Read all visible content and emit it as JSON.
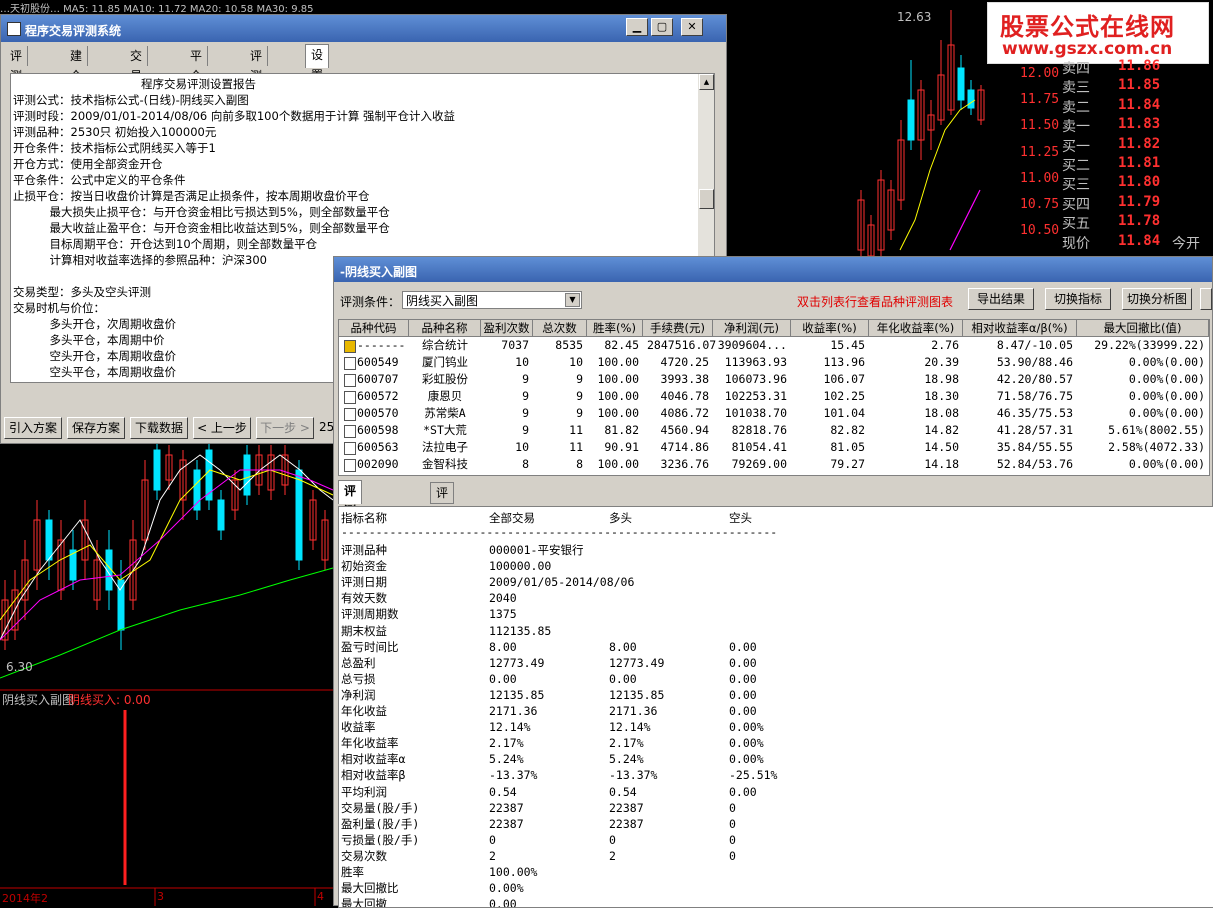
{
  "chart_bg": {
    "top_header": "…天初股份…  MA5: 11.85  MA10: 11.72  MA20: 10.58  MA30: 9.85",
    "high_label": "12.63",
    "price_axis": [
      "12.00",
      "11.75",
      "11.50",
      "11.25",
      "11.00",
      "10.75",
      "10.50"
    ],
    "low_label": "6.30",
    "sub_title": "阴线买入副图",
    "sub_value": "阴线买入: 0.00",
    "x_labels": [
      "2014年2",
      "3",
      "4"
    ],
    "colors": {
      "up": "#ff3030",
      "down": "#00e5ff",
      "ma1": "#ffffff",
      "ma2": "#ffff00",
      "ma3": "#ff00ff",
      "ma4": "#00ff00"
    }
  },
  "watermark": {
    "line1": "股票公式在线网",
    "line2": "www.gszx.com.cn"
  },
  "quotes": [
    {
      "label": "卖四",
      "value": "11.86"
    },
    {
      "label": "卖三",
      "value": "11.85"
    },
    {
      "label": "卖二",
      "value": "11.84"
    },
    {
      "label": "卖一",
      "value": "11.83"
    },
    {
      "label": "买一",
      "value": "11.82"
    },
    {
      "label": "买二",
      "value": "11.81"
    },
    {
      "label": "买三",
      "value": "11.80"
    },
    {
      "label": "买四",
      "value": "11.79"
    },
    {
      "label": "买五",
      "value": "11.78"
    },
    {
      "label": "现价",
      "value": "11.84",
      "extra": "今开"
    }
  ],
  "win1": {
    "title": "程序交易评测系统",
    "tabs": [
      "评测公式",
      "建仓规则",
      "交易方式",
      "平仓规则",
      "评测品种",
      "设置报告"
    ],
    "report_lines": [
      "                                   程序交易评测设置报告",
      "评测公式：技术指标公式-(日线)-阴线买入副图",
      "评测时段：2009/01/01-2014/08/06 向前多取100个数据用于计算 强制平仓计入收益",
      "评测品种：2530只 初始投入100000元",
      "开仓条件：技术指标公式阴线买入等于1",
      "开仓方式：使用全部资金开仓",
      "平仓条件：公式中定义的平仓条件",
      "止损平仓：按当日收盘价计算是否满足止损条件，按本周期收盘价平仓",
      "          最大损失止损平仓：与开仓资金相比亏损达到5%，则全部数量平仓",
      "          最大收益止盈平仓：与开仓资金相比收益达到5%，则全部数量平仓",
      "          目标周期平仓：开仓达到10个周期，则全部数量平仓",
      "          计算相对收益率选择的参照品种：沪深300",
      "",
      "交易类型：多头及空头评测",
      "交易时机与价位：",
      "          多头开仓，次周期收盘价",
      "          多头平仓，本周期中价",
      "          空头开仓，本周期收盘价",
      "          空头平仓，本周期收盘价"
    ],
    "buttons": [
      "引入方案",
      "保存方案",
      "下载数据",
      "< 上一步",
      "下一步 >"
    ],
    "trail": "25"
  },
  "win2": {
    "title": "-阴线买入副图",
    "cond_label": "评测条件：",
    "cond_value": "阴线买入副图",
    "hint": "双击列表行查看品种评测图表",
    "buttons": [
      "导出结果",
      "切换指标",
      "切换分析图"
    ],
    "columns": [
      "品种代码",
      "品种名称",
      "盈利次数",
      "总次数",
      "胜率(%)",
      "手续费(元)",
      "净利润(元)",
      "收益率(%)",
      "年化收益率(%)",
      "相对收益率α/β(%)",
      "最大回撤比(值)"
    ],
    "rows": [
      [
        "-------",
        "综合统计",
        "7037",
        "8535",
        "82.45",
        "2847516.07",
        "3909604...",
        "15.45",
        "2.76",
        "8.47/-10.05",
        "29.22%(33999.22)"
      ],
      [
        "600549",
        "厦门钨业",
        "10",
        "10",
        "100.00",
        "4720.25",
        "113963.93",
        "113.96",
        "20.39",
        "53.90/88.46",
        "0.00%(0.00)"
      ],
      [
        "600707",
        "彩虹股份",
        "9",
        "9",
        "100.00",
        "3993.38",
        "106073.96",
        "106.07",
        "18.98",
        "42.20/80.57",
        "0.00%(0.00)"
      ],
      [
        "600572",
        "康恩贝",
        "9",
        "9",
        "100.00",
        "4046.78",
        "102253.31",
        "102.25",
        "18.30",
        "71.58/76.75",
        "0.00%(0.00)"
      ],
      [
        "000570",
        "苏常柴A",
        "9",
        "9",
        "100.00",
        "4086.72",
        "101038.70",
        "101.04",
        "18.08",
        "46.35/75.53",
        "0.00%(0.00)"
      ],
      [
        "600598",
        "*ST大荒",
        "9",
        "11",
        "81.82",
        "4560.94",
        "82818.76",
        "82.82",
        "14.82",
        "41.28/57.31",
        "5.61%(8002.55)"
      ],
      [
        "600563",
        "法拉电子",
        "10",
        "11",
        "90.91",
        "4714.86",
        "81054.41",
        "81.05",
        "14.50",
        "35.84/55.55",
        "2.58%(4072.33)"
      ],
      [
        "002090",
        "金智科技",
        "8",
        "8",
        "100.00",
        "3236.76",
        "79269.00",
        "79.27",
        "14.18",
        "52.84/53.76",
        "0.00%(0.00)"
      ]
    ],
    "tabs": [
      "评测指标详情",
      "评测指标说明"
    ],
    "detail_header": [
      "指标名称",
      "全部交易",
      "多头",
      "空头"
    ],
    "detail_rule": "------------------------------------------------------------------------------------------",
    "detail_rows": [
      [
        "评测品种",
        "000001-平安银行",
        "",
        ""
      ],
      [
        "初始资金",
        "100000.00",
        "",
        ""
      ],
      [
        "评测日期",
        "2009/01/05-2014/08/06",
        "",
        ""
      ],
      [
        "有效天数",
        "2040",
        "",
        ""
      ],
      [
        "评测周期数",
        "1375",
        "",
        ""
      ],
      [
        "期末权益",
        "112135.85",
        "",
        ""
      ],
      [
        "盈亏时间比",
        "8.00",
        "8.00",
        "0.00"
      ],
      [
        "总盈利",
        "12773.49",
        "12773.49",
        "0.00"
      ],
      [
        "总亏损",
        "0.00",
        "0.00",
        "0.00"
      ],
      [
        "净利润",
        "12135.85",
        "12135.85",
        "0.00"
      ],
      [
        "年化收益",
        "2171.36",
        "2171.36",
        "0.00"
      ],
      [
        "收益率",
        "12.14%",
        "12.14%",
        "0.00%"
      ],
      [
        "年化收益率",
        "2.17%",
        "2.17%",
        "0.00%"
      ],
      [
        "相对收益率α",
        "5.24%",
        " 5.24%",
        " 0.00%"
      ],
      [
        "相对收益率β",
        "-13.37%",
        " -13.37%",
        " -25.51%"
      ],
      [
        "平均利润",
        "0.54",
        "0.54",
        "0.00"
      ],
      [
        "交易量(股/手)",
        "22387",
        "22387",
        "0"
      ],
      [
        "盈利量(股/手)",
        "22387",
        "22387",
        "0"
      ],
      [
        "亏损量(股/手)",
        "0",
        "0",
        "0"
      ],
      [
        "交易次数",
        "2",
        "2",
        "0"
      ],
      [
        "胜率",
        "100.00%",
        "",
        ""
      ],
      [
        "最大回撤比",
        "0.00%",
        "",
        ""
      ],
      [
        "最大回撤",
        "0.00",
        "",
        ""
      ]
    ]
  }
}
